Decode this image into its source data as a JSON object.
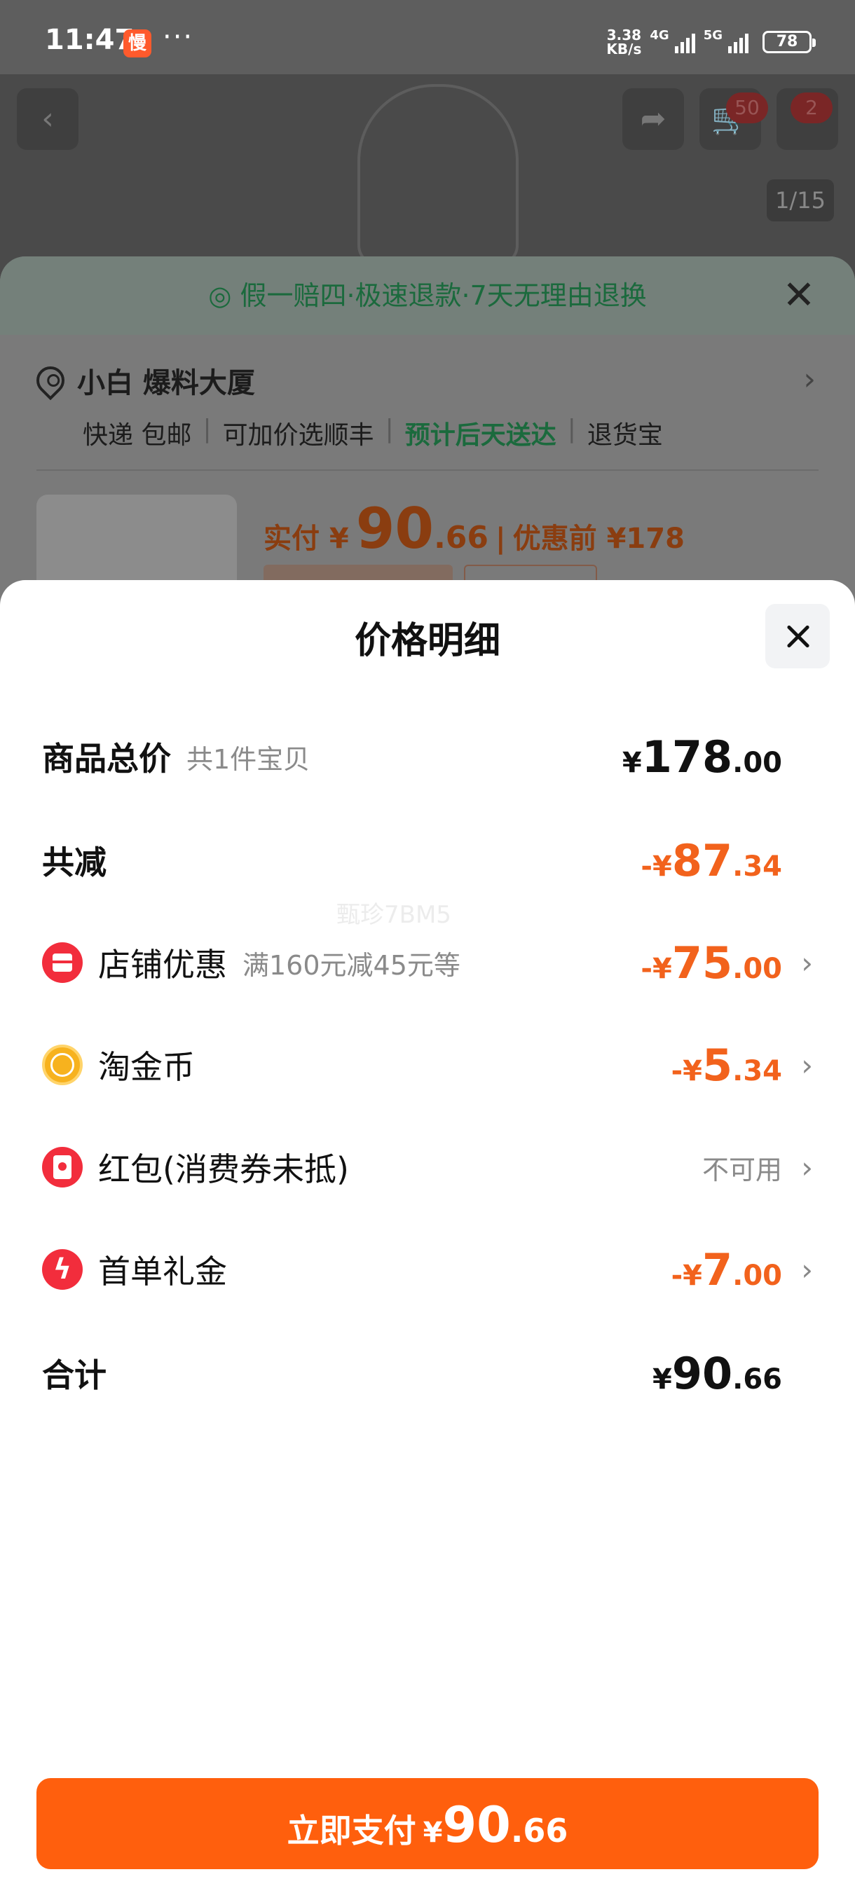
{
  "status_bar": {
    "time": "11:47",
    "app_icon_text": "慢",
    "more": "···",
    "net_speed_value": "3.38",
    "net_speed_unit": "KB/s",
    "sim1": "4G",
    "sim2": "5G",
    "battery": "78"
  },
  "background_page": {
    "cart_count": "50",
    "msg_count": "2",
    "image_counter": "1/15"
  },
  "order_sheet": {
    "guarantee": "假一赔四·极速退款·7天无理由退换",
    "address": "小白 爆料大厦",
    "shipping": [
      "快递 包邮",
      "可加价选顺丰",
      "预计后天送达",
      "退货宝"
    ],
    "price_label": "实付 ¥",
    "price_int": "90",
    "price_dec": ".66",
    "price_before": "优惠前 ¥178"
  },
  "price_detail": {
    "title": "价格明细",
    "rows": [
      {
        "label": "商品总价",
        "sub": "共1件宝贝",
        "sym": "¥",
        "int": "178",
        "dec": ".00"
      },
      {
        "label": "共减",
        "sym": "-¥",
        "int": "87",
        "dec": ".34"
      },
      {
        "label": "店铺优惠",
        "sub": "满160元减45元等",
        "icon": "shop-icon",
        "sym": "-¥",
        "int": "75",
        "dec": ".00"
      },
      {
        "label": "淘金币",
        "icon": "coin-icon",
        "sym": "-¥",
        "int": "5",
        "dec": ".34"
      },
      {
        "label": "红包(消费券未抵)",
        "icon": "red-packet-icon",
        "value": "不可用"
      },
      {
        "label": "首单礼金",
        "icon": "lightning-icon",
        "sym": "-¥",
        "int": "7",
        "dec": ".00"
      },
      {
        "label": "合计",
        "sym": "¥",
        "int": "90",
        "dec": ".66"
      }
    ],
    "watermark": "甄珍7BM5"
  },
  "pay_button": {
    "label": "立即支付",
    "sym": "¥",
    "int": "90",
    "dec": ".66"
  },
  "colors": {
    "accent_orange": "#ff5f0d",
    "discount_orange": "#f2621c",
    "green": "#1b6a3d"
  }
}
